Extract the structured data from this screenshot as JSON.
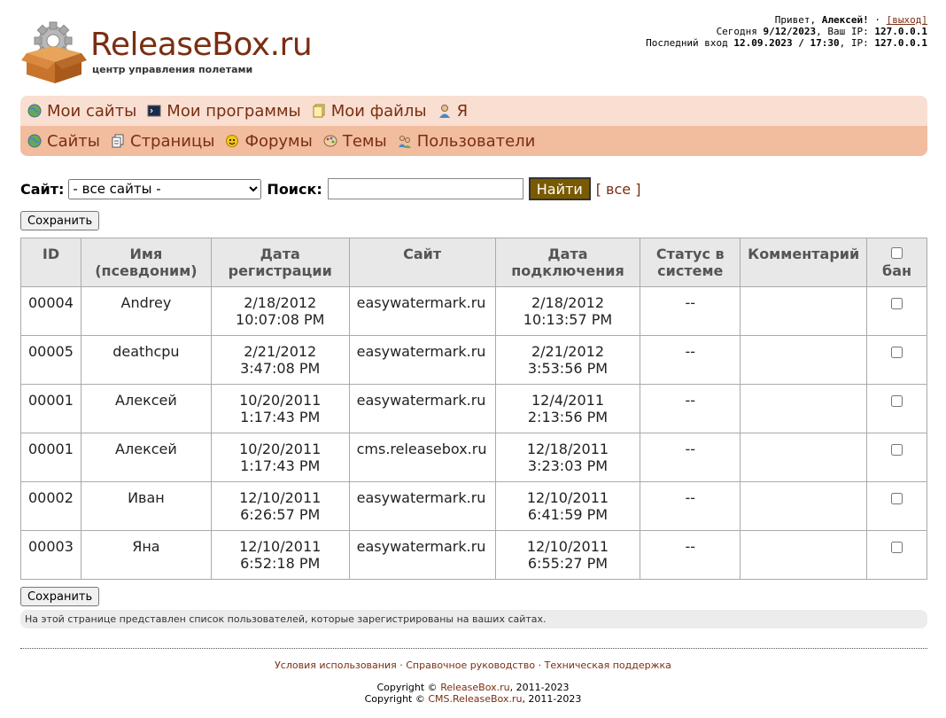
{
  "header": {
    "logo_text": "ReleaseBox.ru",
    "logo_sub": "центр управления полетами",
    "greeting_prefix": "Привет, ",
    "user_name": "Алексей!",
    "logout_label": "[выход]",
    "today_label": "Сегодня ",
    "today_value": "9/12/2023",
    "ip_label": ", Ваш IP: ",
    "ip_value": "127.0.0.1",
    "last_login_label": "Последний вход ",
    "last_login_value": "12.09.2023 / 17:30",
    "last_ip_label": ", IP: ",
    "last_ip_value": "127.0.0.1"
  },
  "menu1": [
    {
      "label": "Мои сайты",
      "icon": "globe-icon"
    },
    {
      "label": "Мои программы",
      "icon": "terminal-icon"
    },
    {
      "label": "Мои файлы",
      "icon": "files-icon"
    },
    {
      "label": "Я",
      "icon": "person-icon"
    }
  ],
  "menu2": [
    {
      "label": "Сайты",
      "icon": "globe-icon"
    },
    {
      "label": "Страницы",
      "icon": "pages-icon"
    },
    {
      "label": "Форумы",
      "icon": "smiley-icon"
    },
    {
      "label": "Темы",
      "icon": "palette-icon"
    },
    {
      "label": "Пользователи",
      "icon": "users-icon"
    }
  ],
  "search": {
    "site_label": "Сайт:",
    "site_selected": "- все сайты -",
    "search_label": "Поиск:",
    "search_value": "",
    "find_button": "Найти",
    "all_link": "[ все ]"
  },
  "save_label": "Сохранить",
  "table": {
    "headers": {
      "id": "ID",
      "name_1": "Имя",
      "name_2": "(псевдоним)",
      "regdate_1": "Дата",
      "regdate_2": "регистрации",
      "site": "Сайт",
      "conndate_1": "Дата",
      "conndate_2": "подключения",
      "status_1": "Статус в",
      "status_2": "системе",
      "comment": "Комментарий",
      "ban": "бан"
    },
    "rows": [
      {
        "id": "00004",
        "name": "Andrey",
        "reg_date": "2/18/2012",
        "reg_time": "10:07:08 PM",
        "site": "easywatermark.ru",
        "conn_date": "2/18/2012",
        "conn_time": "10:13:57 PM",
        "status": "--",
        "comment": ""
      },
      {
        "id": "00005",
        "name": "deathcpu",
        "reg_date": "2/21/2012",
        "reg_time": "3:47:08 PM",
        "site": "easywatermark.ru",
        "conn_date": "2/21/2012",
        "conn_time": "3:53:56 PM",
        "status": "--",
        "comment": ""
      },
      {
        "id": "00001",
        "name": "Алексей",
        "reg_date": "10/20/2011",
        "reg_time": "1:17:43 PM",
        "site": "easywatermark.ru",
        "conn_date": "12/4/2011",
        "conn_time": "2:13:56 PM",
        "status": "--",
        "comment": ""
      },
      {
        "id": "00001",
        "name": "Алексей",
        "reg_date": "10/20/2011",
        "reg_time": "1:17:43 PM",
        "site": "cms.releasebox.ru",
        "conn_date": "12/18/2011",
        "conn_time": "3:23:03 PM",
        "status": "--",
        "comment": ""
      },
      {
        "id": "00002",
        "name": "Иван",
        "reg_date": "12/10/2011",
        "reg_time": "6:26:57 PM",
        "site": "easywatermark.ru",
        "conn_date": "12/10/2011",
        "conn_time": "6:41:59 PM",
        "status": "--",
        "comment": ""
      },
      {
        "id": "00003",
        "name": "Яна",
        "reg_date": "12/10/2011",
        "reg_time": "6:52:18 PM",
        "site": "easywatermark.ru",
        "conn_date": "12/10/2011",
        "conn_time": "6:55:27 PM",
        "status": "--",
        "comment": ""
      }
    ]
  },
  "note": "На этой странице представлен список пользователей, которые зарегистрированы на ваших сайтах.",
  "footer": {
    "links": [
      "Условия использования",
      "Справочное руководство",
      "Техническая поддержка"
    ],
    "sep": " · ",
    "copy_prefix": "Copyright © ",
    "copy1_link": "ReleaseBox.ru",
    "copy2_link": "CMS.ReleaseBox.ru",
    "copy_years": ", 2011-2023"
  },
  "colors": {
    "brand": "#7a2e12",
    "menu_top": "#f9dfd1",
    "menu_bottom": "#f2bc9f",
    "find_button": "#7a5a00"
  }
}
